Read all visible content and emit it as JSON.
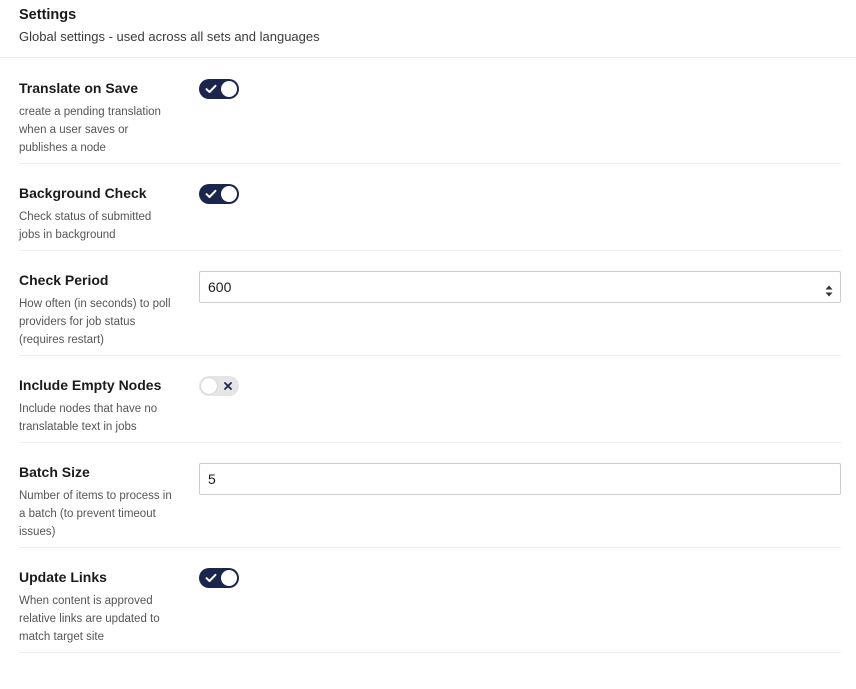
{
  "header": {
    "title": "Settings",
    "subtitle": "Global settings - used across all sets and languages"
  },
  "settings": {
    "translate_on_save": {
      "label": "Translate on Save",
      "desc1": "create a pending translation",
      "desc2": "when a user saves or",
      "desc3": "publishes a node",
      "enabled": true
    },
    "background_check": {
      "label": "Background Check",
      "desc1": "Check status of submitted",
      "desc2": "jobs in background",
      "enabled": true
    },
    "check_period": {
      "label": "Check Period",
      "desc1": "How often (in seconds) to poll",
      "desc2": "providers for job status",
      "desc3": "(requires restart)",
      "value": "600"
    },
    "include_empty_nodes": {
      "label": "Include Empty Nodes",
      "desc1": "Include nodes that have no",
      "desc2": "translatable text in jobs",
      "enabled": false
    },
    "batch_size": {
      "label": "Batch Size",
      "desc1": "Number of items to process in",
      "desc2": "a batch (to prevent timeout",
      "desc3": "issues)",
      "value": "5"
    },
    "update_links": {
      "label": "Update Links",
      "desc1": "When content is approved",
      "desc2": "relative links are updated to",
      "desc3": "match target site",
      "enabled": true
    }
  },
  "icons": {
    "toggle_on": "check-icon",
    "toggle_off": "x-icon",
    "spinner": "spinner-arrows-icon"
  },
  "colors": {
    "accent": "#1b264f",
    "toggle_off_bg": "#e5e5e5"
  }
}
